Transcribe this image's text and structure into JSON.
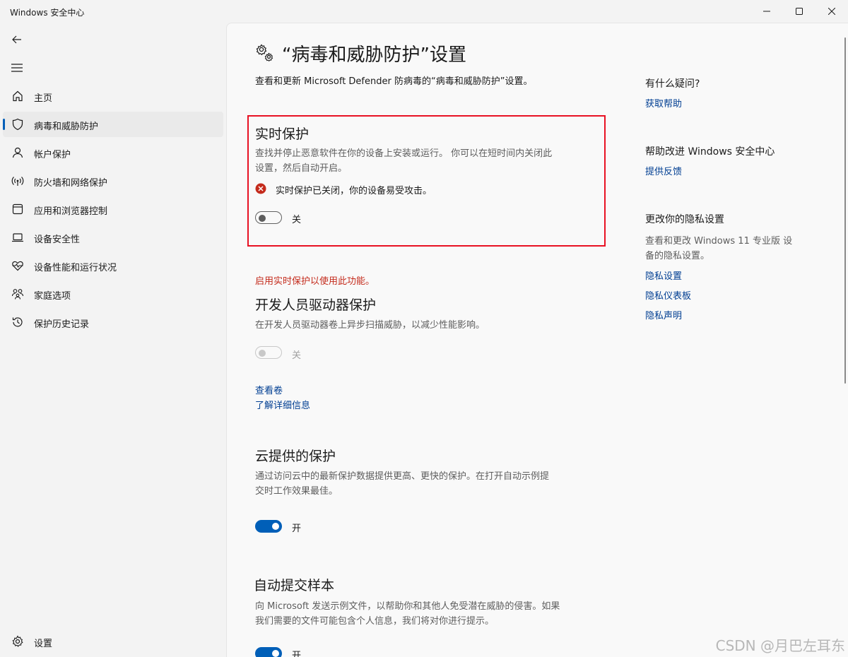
{
  "app": {
    "title": "Windows 安全中心"
  },
  "sidebar": {
    "items": [
      {
        "label": "主页",
        "icon": "home-icon"
      },
      {
        "label": "病毒和威胁防护",
        "icon": "shield-icon",
        "selected": true
      },
      {
        "label": "帐户保护",
        "icon": "person-icon"
      },
      {
        "label": "防火墙和网络保护",
        "icon": "wifi-signal-icon"
      },
      {
        "label": "应用和浏览器控制",
        "icon": "app-window-icon"
      },
      {
        "label": "设备安全性",
        "icon": "laptop-icon"
      },
      {
        "label": "设备性能和运行状况",
        "icon": "heart-pulse-icon"
      },
      {
        "label": "家庭选项",
        "icon": "family-icon"
      },
      {
        "label": "保护历史记录",
        "icon": "history-icon"
      }
    ],
    "settings_label": "设置"
  },
  "main": {
    "title": "“病毒和威胁防护”设置",
    "subtitle": "查看和更新 Microsoft Defender 防病毒的“病毒和威胁防护”设置。",
    "realtime": {
      "title": "实时保护",
      "desc_line1": "查找并停止恶意软件在你的设备上安装或运行。 你可以在短时间内关闭此",
      "desc_line2": "设置，然后自动开启。",
      "warning": "实时保护已关闭，你的设备易受攻击。",
      "toggle_label": "关",
      "toggle_on": false
    },
    "dev_drive": {
      "notice": "启用实时保护以使用此功能。",
      "title": "开发人员驱动器保护",
      "desc": "在开发人员驱动器卷上异步扫描威胁，以减少性能影响。",
      "toggle_label": "关",
      "toggle_on": false,
      "link_view": "查看卷",
      "link_learn": "了解详细信息"
    },
    "cloud": {
      "title": "云提供的保护",
      "desc_line1": "通过访问云中的最新保护数据提供更高、更快的保护。在打开自动示例提",
      "desc_line2": "交时工作效果最佳。",
      "toggle_label": "开",
      "toggle_on": true
    },
    "sample": {
      "title": "自动提交样本",
      "desc_line1": "向 Microsoft 发送示例文件，以帮助你和其他人免受潜在威胁的侵害。如果",
      "desc_line2": "我们需要的文件可能包含个人信息，我们将对你进行提示。",
      "toggle_label": "开",
      "toggle_on": true
    }
  },
  "aside": {
    "question_title": "有什么疑问?",
    "get_help": "获取帮助",
    "improve_title": "帮助改进 Windows 安全中心",
    "feedback": "提供反馈",
    "privacy_title": "更改你的隐私设置",
    "privacy_desc_line1": "查看和更改 Windows 11 专业版 设",
    "privacy_desc_line2": "备的隐私设置。",
    "privacy_settings": "隐私设置",
    "privacy_dashboard": "隐私仪表板",
    "privacy_statement": "隐私声明"
  },
  "watermark": "CSDN @月巴左耳东",
  "colors": {
    "accent": "#005fb8",
    "error": "#c42b1c",
    "highlight_border": "#e81123",
    "link": "#003e92"
  }
}
